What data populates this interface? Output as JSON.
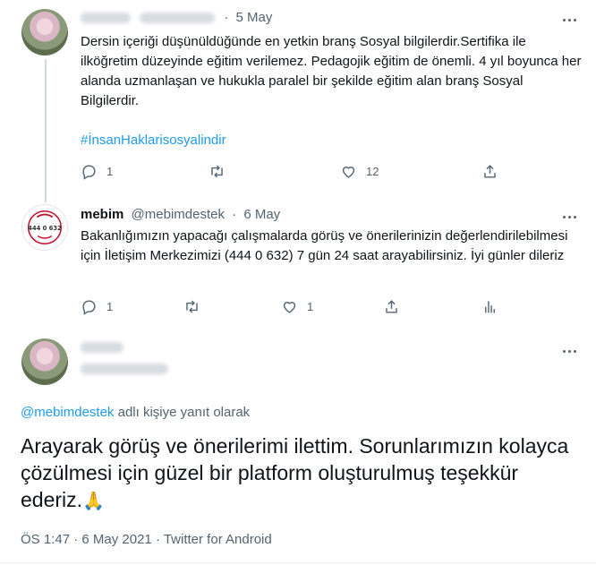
{
  "tweet1": {
    "date": "5 May",
    "separator": "·",
    "text": "Dersin içeriği düşünüldüğünde en yetkin branş Sosyal bilgilerdir.Sertifika ile ilköğretim düzeyinde eğitim verilemez. Pedagojik eğitim de önemli. 4 yıl boyunca her alanda uzmanlaşan ve hukukla paralel bir şekilde eğitim alan branş Sosyal Bilgilerdir.",
    "hashtag": "#İnsanHaklarisosyalindir",
    "reply_count": "1",
    "like_count": "12"
  },
  "tweet2": {
    "display_name": "mebim",
    "handle": "@mebimdestek",
    "separator": "·",
    "date": "6 May",
    "logo_text": "444 0 632",
    "text": "Bakanlığımızın yapacağı çalışmalarda görüş ve önerilerinizin değerlendirilebilmesi için İletişim Merkezimizi (444 0 632) 7 gün 24 saat arayabilirsiniz. İyi günler dileriz",
    "reply_count": "1",
    "like_count": "1"
  },
  "focus_tweet": {
    "reply_to_handle": "@mebimdestek",
    "reply_to_suffix": " adlı kişiye yanıt olarak",
    "text": "Arayarak görüş ve önerilerimi ilettim. Sorunlarımızın kolayca çözülmesi için güzel bir platform oluşturulmuş teşekkür ederiz.",
    "emoji": "🙏",
    "time": "ÖS 1:47",
    "separator1": " · ",
    "date": "6 May 2021",
    "separator2": " · ",
    "source": "Twitter for Android"
  },
  "icons": {
    "reply": "reply-icon",
    "retweet": "retweet-icon",
    "like": "heart-icon",
    "share": "share-icon",
    "analytics": "analytics-icon",
    "more": "more-icon"
  },
  "colors": {
    "link": "#1d9bf0",
    "muted": "#536471",
    "text": "#0f1419",
    "thread_line": "#cfd9de",
    "logo_red": "#c8102e"
  }
}
